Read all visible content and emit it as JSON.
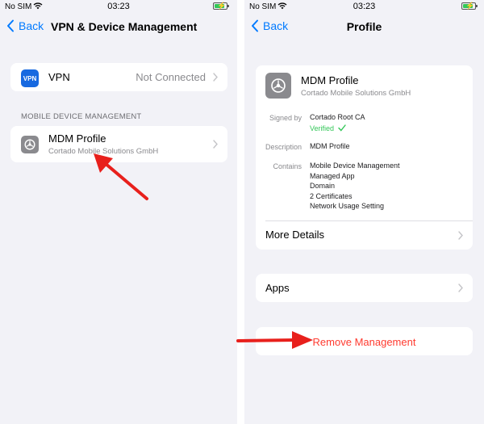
{
  "left": {
    "status": {
      "carrier": "No SIM",
      "time": "03:23"
    },
    "nav": {
      "back": "Back",
      "title": "VPN & Device Management"
    },
    "vpn_row": {
      "icon_text": "VPN",
      "label": "VPN",
      "value": "Not Connected"
    },
    "mdm_section": {
      "header": "MOBILE DEVICE MANAGEMENT"
    },
    "mdm_row": {
      "label": "MDM Profile",
      "subtitle": "Cortado Mobile Solutions GmbH"
    }
  },
  "right": {
    "status": {
      "carrier": "No SIM",
      "time": "03:23"
    },
    "nav": {
      "back": "Back",
      "title": "Profile"
    },
    "profile": {
      "name": "MDM Profile",
      "organization": "Cortado Mobile Solutions GmbH",
      "signed_by_label": "Signed by",
      "signed_by_value": "Cortado Root CA",
      "verified": "Verified",
      "description_label": "Description",
      "description_value": "MDM Profile",
      "contains_label": "Contains",
      "contains_items": [
        "Mobile Device Management",
        "Managed App",
        "Domain",
        "2 Certificates",
        "Network Usage Setting"
      ],
      "more_details": "More Details"
    },
    "apps_row": {
      "label": "Apps"
    },
    "remove_button": {
      "label": "Remove Management"
    }
  },
  "colors": {
    "accent": "#007aff",
    "danger": "#ff3b30",
    "verified": "#34c759",
    "annotation_arrow": "#e8201c"
  }
}
